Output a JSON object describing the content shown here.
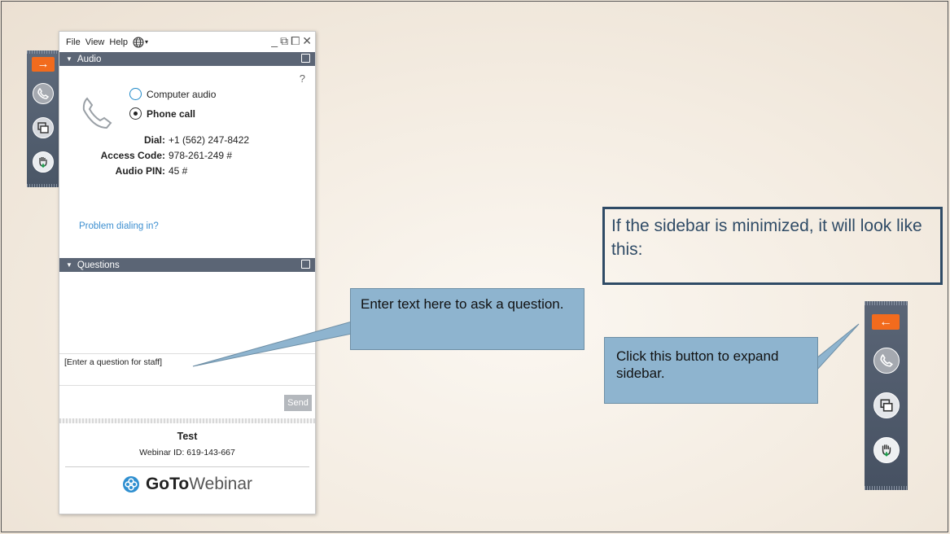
{
  "menu": {
    "items": [
      "File",
      "View",
      "Help"
    ]
  },
  "window_controls": {
    "minimize": "_",
    "restore": "⧉",
    "popout": "⧠",
    "close": "✕"
  },
  "sidebar_left": {
    "expand_arrow": "→"
  },
  "audio": {
    "header": "Audio",
    "help": "?",
    "options": [
      {
        "label": "Computer audio",
        "selected": false
      },
      {
        "label": "Phone call",
        "selected": true
      }
    ],
    "dial_label": "Dial:",
    "dial_value": "+1 (562) 247-8422",
    "access_code_label": "Access Code:",
    "access_code_value": "978-261-249 #",
    "audio_pin_label": "Audio PIN:",
    "audio_pin_value": "45 #",
    "problem_link": "Problem dialing in?"
  },
  "questions": {
    "header": "Questions",
    "input_placeholder": "[Enter a question for staff]",
    "send_label": "Send"
  },
  "footer": {
    "title": "Test",
    "webinar_id": "Webinar ID: 619-143-667",
    "brand_goto": "GoTo",
    "brand_webinar": "Webinar"
  },
  "callouts": {
    "question_hint": "Enter text here to ask a question.",
    "minimized_note": "If the sidebar is minimized, it will look like this:",
    "expand_hint": "Click this button to expand sidebar."
  },
  "sidebar_right": {
    "expand_arrow": "←"
  },
  "colors": {
    "accent_orange": "#f26b1d",
    "header_slate": "#5b6575",
    "callout_blue": "#8eb4cf",
    "note_border": "#2f4b66",
    "link_blue": "#3d8fd0"
  },
  "icons": [
    "orange-arrow-right-icon",
    "phone-icon",
    "popout-icon",
    "raise-hand-icon",
    "globe-icon",
    "gotowebinar-logo-icon"
  ]
}
